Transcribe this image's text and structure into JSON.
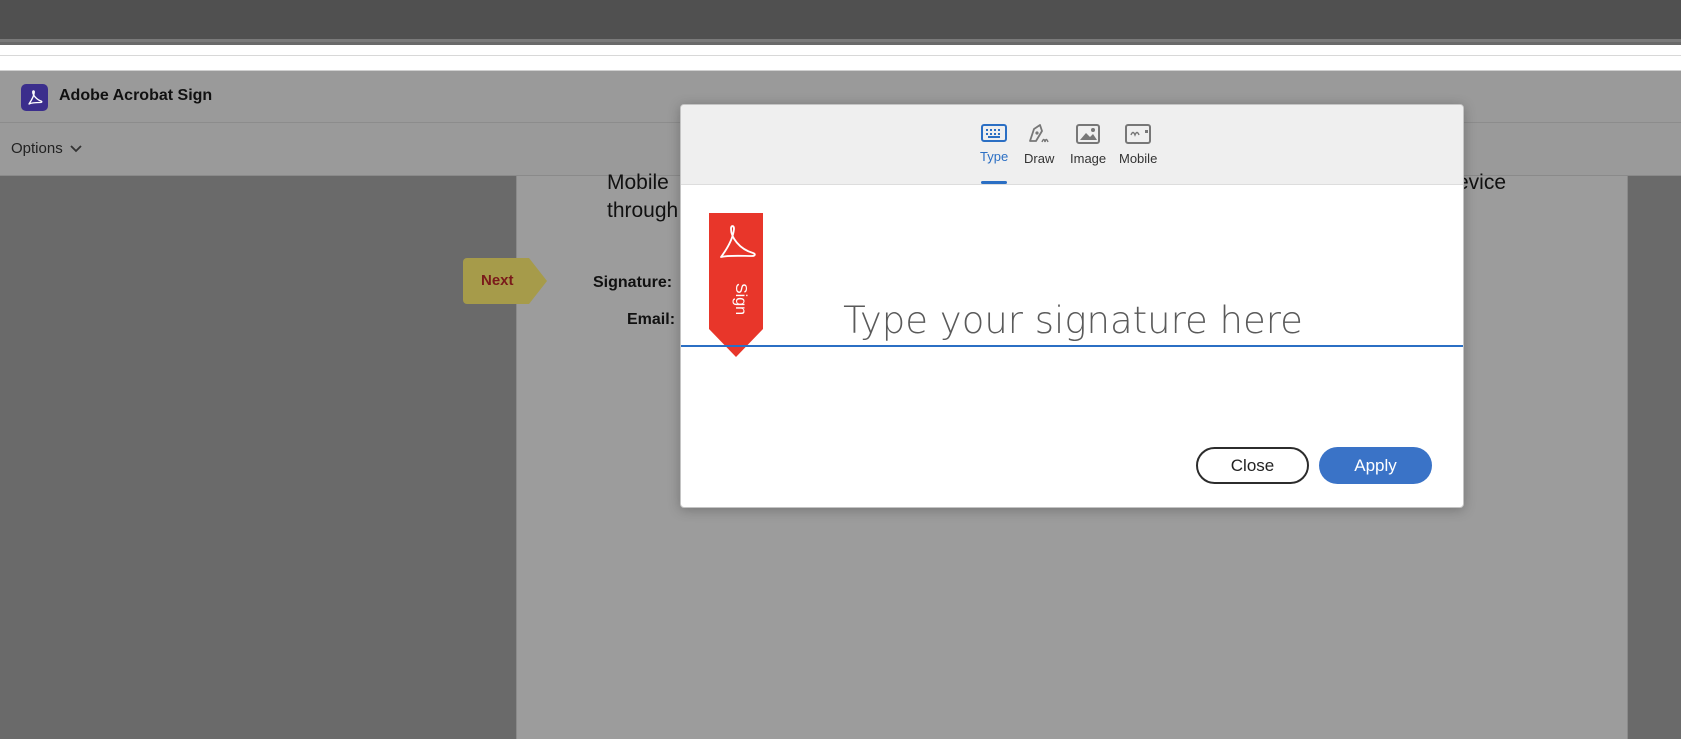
{
  "app": {
    "title": "Adobe Acrobat Sign",
    "logo_icon": "acrobat-logo-icon"
  },
  "toolbar": {
    "options_label": "Options"
  },
  "document": {
    "line1_left": "Mobile",
    "line1_right": "evice",
    "line2_left": "through",
    "signature_label": "Signature:",
    "email_label": "Email:",
    "next_label": "Next"
  },
  "modal": {
    "tabs": [
      {
        "label": "Type",
        "icon": "keyboard-icon",
        "active": true
      },
      {
        "label": "Draw",
        "icon": "pen-icon",
        "active": false
      },
      {
        "label": "Image",
        "icon": "image-icon",
        "active": false
      },
      {
        "label": "Mobile",
        "icon": "mobile-icon",
        "active": false
      }
    ],
    "ribbon_label": "Sign",
    "signature_placeholder": "Type your signature here",
    "close_label": "Close",
    "apply_label": "Apply"
  },
  "colors": {
    "accent": "#2b6fc4",
    "apply_button": "#3a73c7",
    "ribbon": "#e8362a",
    "next_tag": "#a69b4a"
  }
}
